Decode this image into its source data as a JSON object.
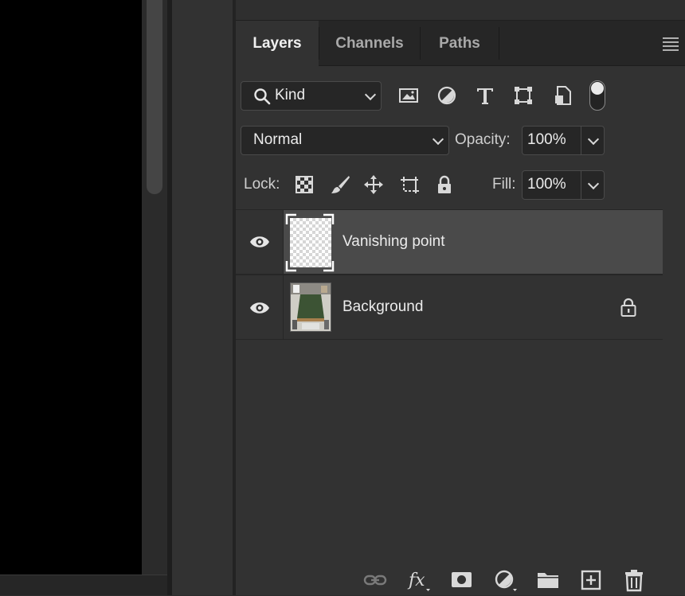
{
  "panel": {
    "tabs": [
      {
        "label": "Layers",
        "active": true
      },
      {
        "label": "Channels",
        "active": false
      },
      {
        "label": "Paths",
        "active": false
      }
    ],
    "menu_icon": "hamburger-menu-icon"
  },
  "filter": {
    "kind_label": "Kind",
    "filter_icons": [
      "image-filter-icon",
      "adjustment-filter-icon",
      "type-filter-icon",
      "shape-filter-icon",
      "smart-object-filter-icon",
      "filter-toggle-switch"
    ]
  },
  "blend": {
    "mode": "Normal",
    "opacity_label": "Opacity:",
    "opacity_value": "100%"
  },
  "lock": {
    "label": "Lock:",
    "icons": [
      "lock-transparent-pixels-icon",
      "lock-image-pixels-icon",
      "lock-position-icon",
      "lock-artboard-icon",
      "lock-all-icon"
    ],
    "fill_label": "Fill:",
    "fill_value": "100%"
  },
  "layers": [
    {
      "name": "Vanishing point",
      "visible": true,
      "selected": true,
      "locked": false
    },
    {
      "name": "Background",
      "visible": true,
      "selected": false,
      "locked": true
    }
  ],
  "bottom_toolbar": [
    "link-layers-icon",
    "fx-icon",
    "layer-mask-icon",
    "adjustment-layer-icon",
    "group-folder-icon",
    "new-layer-icon",
    "trash-icon"
  ],
  "colors": {
    "panel_bg": "#323232",
    "selected_row": "#4a4a4a",
    "canvas": "#000000"
  }
}
